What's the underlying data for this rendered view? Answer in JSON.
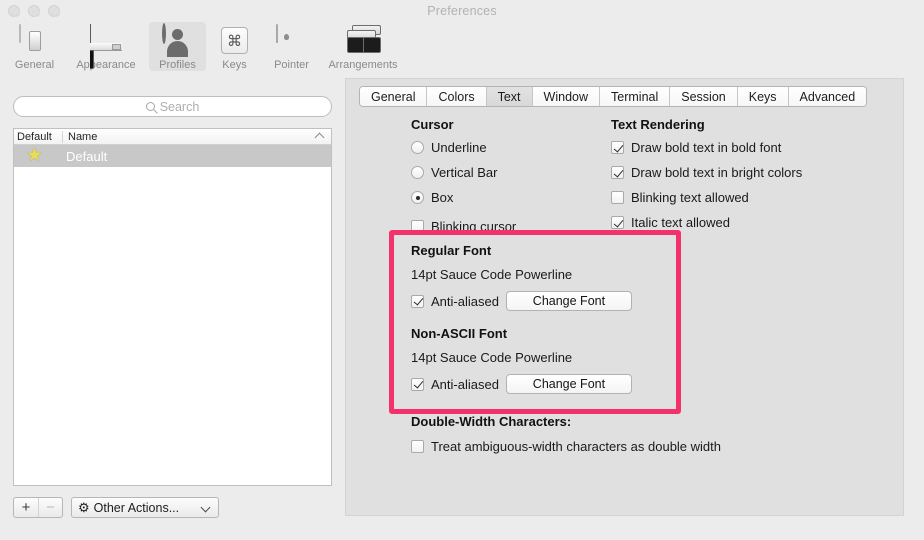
{
  "window": {
    "title": "Preferences",
    "traffic_lights": [
      "close-button",
      "minimize-button",
      "zoom-button"
    ]
  },
  "toolbar": {
    "items": [
      {
        "label": "General",
        "icon": "toggle-switch-icon",
        "selected": false
      },
      {
        "label": "Appearance",
        "icon": "window-appearance-icon",
        "selected": false
      },
      {
        "label": "Profiles",
        "icon": "person-icon",
        "selected": true
      },
      {
        "label": "Keys",
        "icon": "command-key-icon",
        "selected": false
      },
      {
        "label": "Pointer",
        "icon": "mouse-icon",
        "selected": false
      },
      {
        "label": "Arrangements",
        "icon": "stacked-windows-icon",
        "selected": false
      }
    ]
  },
  "sidebar": {
    "search": {
      "placeholder": "Search",
      "value": "",
      "icon": "search-icon"
    },
    "columns": [
      "Default",
      "Name"
    ],
    "sort_indicator": "chevron-up-icon",
    "rows": [
      {
        "star": "★",
        "name": "Default",
        "selected": true
      }
    ],
    "bottom_bar": {
      "add_label": "+",
      "remove_label": "−",
      "other_actions_label": "Other Actions...",
      "gear_icon": "gear-icon",
      "chevron_icon": "chevron-down-icon"
    }
  },
  "tabs": [
    {
      "label": "General",
      "active": false
    },
    {
      "label": "Colors",
      "active": false
    },
    {
      "label": "Text",
      "active": true
    },
    {
      "label": "Window",
      "active": false
    },
    {
      "label": "Terminal",
      "active": false
    },
    {
      "label": "Session",
      "active": false
    },
    {
      "label": "Keys",
      "active": false
    },
    {
      "label": "Advanced",
      "active": false
    }
  ],
  "cursor": {
    "title": "Cursor",
    "options": [
      {
        "label": "Underline",
        "checked": false,
        "type": "radio"
      },
      {
        "label": "Vertical Bar",
        "checked": false,
        "type": "radio"
      },
      {
        "label": "Box",
        "checked": true,
        "type": "radio"
      }
    ],
    "blinking": {
      "label": "Blinking cursor",
      "checked": false,
      "type": "checkbox"
    }
  },
  "text_rendering": {
    "title": "Text Rendering",
    "options": [
      {
        "label": "Draw bold text in bold font",
        "checked": true
      },
      {
        "label": "Draw bold text in bright colors",
        "checked": true
      },
      {
        "label": "Blinking text allowed",
        "checked": false
      },
      {
        "label": "Italic text allowed",
        "checked": true
      }
    ]
  },
  "fonts": {
    "highlight_color": "#f4316a",
    "regular": {
      "title": "Regular Font",
      "value": "14pt Sauce Code Powerline",
      "antialias_label": "Anti-aliased",
      "antialias_checked": true,
      "button_label": "Change Font"
    },
    "non_ascii": {
      "title": "Non-ASCII Font",
      "value": "14pt Sauce Code Powerline",
      "antialias_label": "Anti-aliased",
      "antialias_checked": true,
      "button_label": "Change Font"
    }
  },
  "double_width": {
    "title": "Double-Width Characters:",
    "option": {
      "label": "Treat ambiguous-width characters as double width",
      "checked": false
    }
  }
}
